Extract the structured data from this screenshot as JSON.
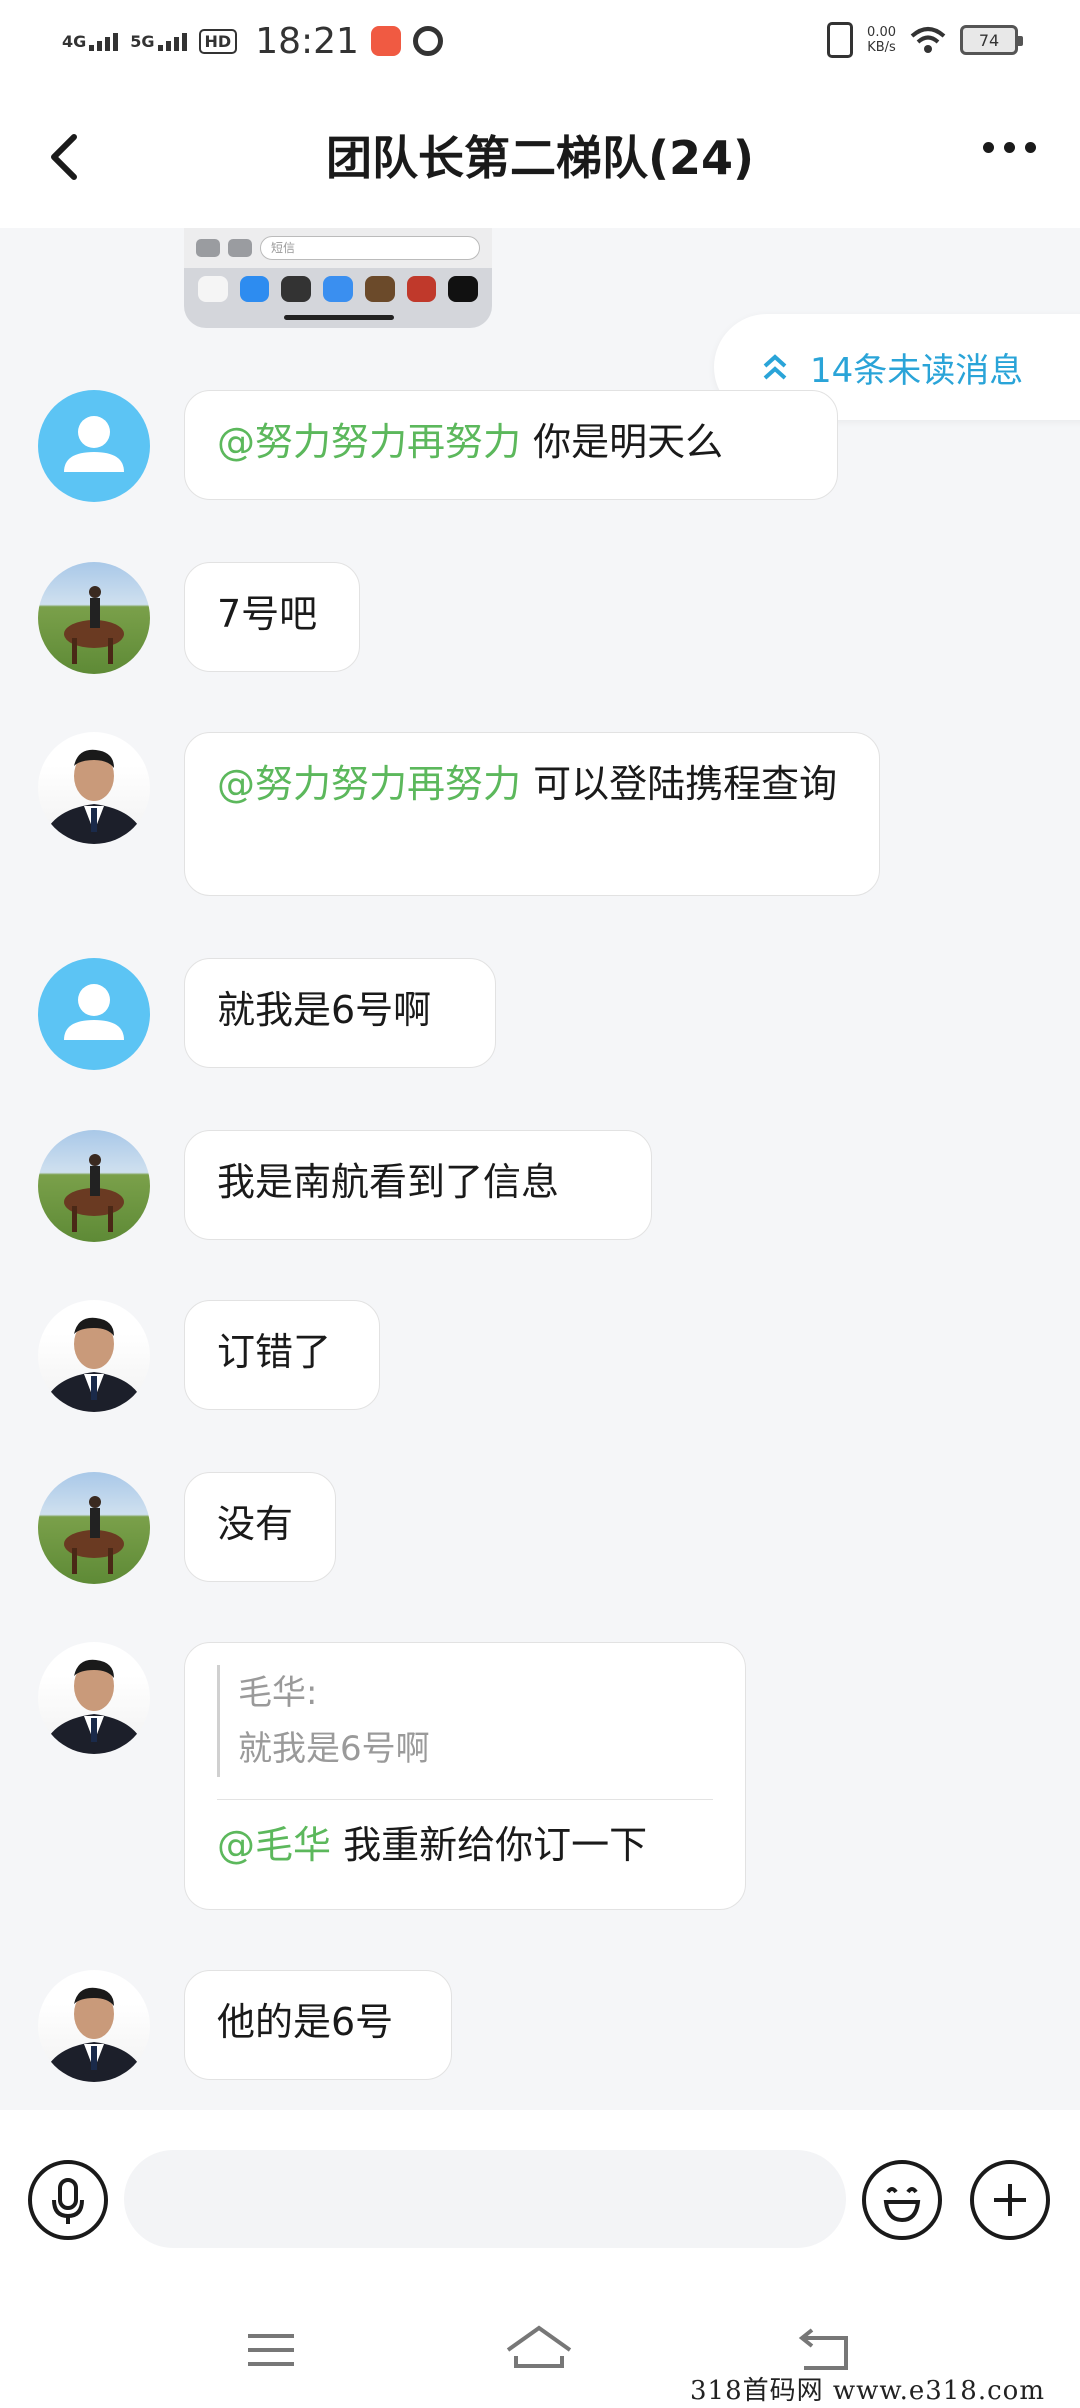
{
  "status_bar": {
    "net1": "4G",
    "net2": "5G",
    "hd": "HD",
    "time": "18:21",
    "speed_value": "0.00",
    "speed_unit": "KB/s",
    "battery": "74"
  },
  "header": {
    "title": "团队长第二梯队(24)"
  },
  "image_message": {
    "field_placeholder": "短信"
  },
  "unread_banner": {
    "label": "14条未读消息"
  },
  "messages": [
    {
      "avatar": "default",
      "mention": "@努力努力再努力",
      "text": " 你是明天么"
    },
    {
      "avatar": "horse",
      "text": "7号吧"
    },
    {
      "avatar": "man",
      "mention": "@努力努力再努力",
      "text": " 可以登陆携程查询"
    },
    {
      "avatar": "default",
      "text": "就我是6号啊"
    },
    {
      "avatar": "horse",
      "text": "我是南航看到了信息"
    },
    {
      "avatar": "man",
      "text": "订错了"
    },
    {
      "avatar": "horse",
      "text": "没有"
    },
    {
      "avatar": "man",
      "quote_author": "毛华:",
      "quote_text": "就我是6号啊",
      "mention": "@毛华",
      "text": " 我重新给你订一下"
    },
    {
      "avatar": "man",
      "text": "他的是6号"
    }
  ],
  "input_bar": {
    "placeholder": ""
  },
  "watermark": "318首码网   www.e318.com",
  "colors": {
    "accent": "#2aa4d8",
    "mention": "#5cb85c",
    "default_avatar": "#5cc4f4",
    "background": "#f5f6f8"
  },
  "icons": [
    "back-arrow-icon",
    "more-dots-icon",
    "double-chevron-up-icon",
    "microphone-icon",
    "emoji-icon",
    "plus-icon",
    "menu-icon",
    "home-icon",
    "back-nav-icon",
    "default-user-icon"
  ]
}
